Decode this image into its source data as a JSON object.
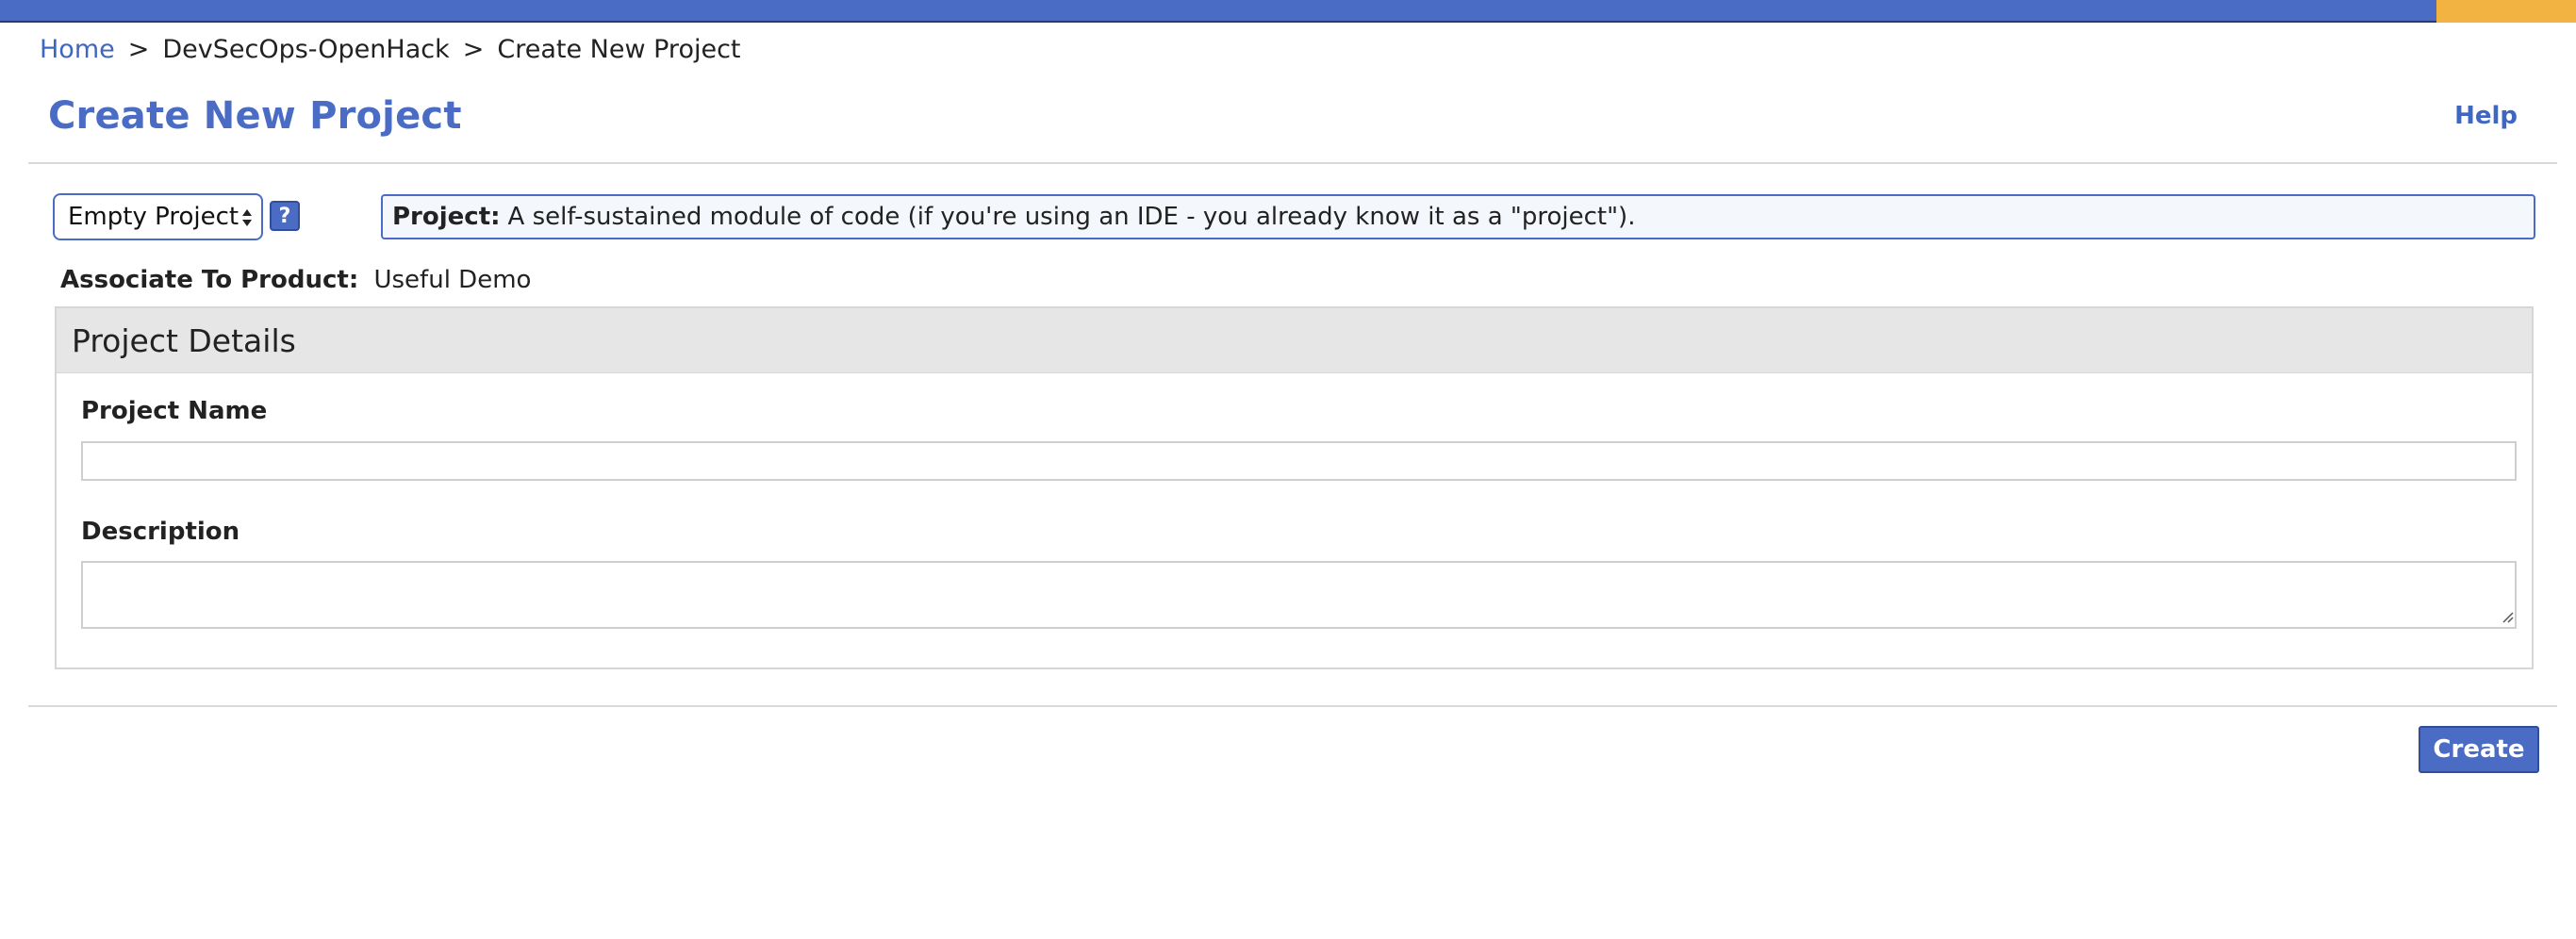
{
  "colors": {
    "brand_blue": "#4a6cc4",
    "accent_orange": "#f2b342",
    "panel_header_bg": "#e6e6e6",
    "border_gray": "#d6d6d6"
  },
  "breadcrumb": {
    "items": [
      {
        "label": "Home",
        "link": true
      },
      {
        "label": "DevSecOps-OpenHack",
        "link": false
      },
      {
        "label": "Create New Project",
        "link": false
      }
    ],
    "separator": ">"
  },
  "header": {
    "title": "Create New Project",
    "help_label": "Help"
  },
  "template": {
    "selected": "Empty Project",
    "help_icon_glyph": "?",
    "help_icon_name": "question-help-icon"
  },
  "info": {
    "label": "Project:",
    "text": "A self-sustained module of code (if you're using an IDE - you already know it as a \"project\")."
  },
  "associate": {
    "label": "Associate To Product:",
    "value": "Useful Demo"
  },
  "details_panel": {
    "title": "Project Details",
    "name_label": "Project Name",
    "name_value": "",
    "description_label": "Description",
    "description_value": ""
  },
  "actions": {
    "create_label": "Create"
  }
}
